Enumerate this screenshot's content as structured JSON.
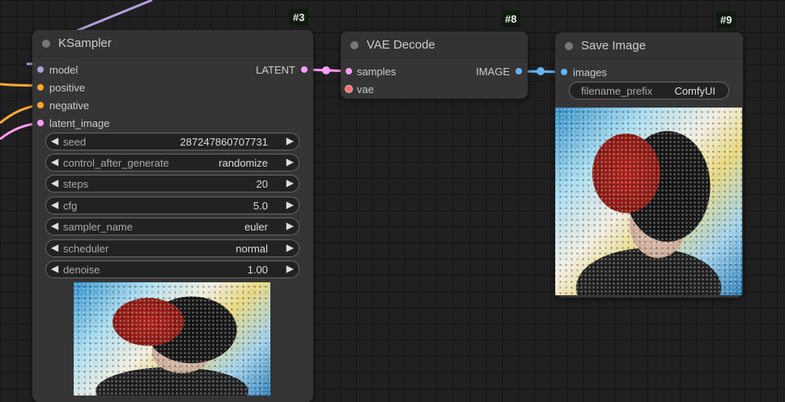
{
  "nodes": {
    "ksampler": {
      "id": "#3",
      "title": "KSampler",
      "inputs": [
        "model",
        "positive",
        "negative",
        "latent_image"
      ],
      "output": "LATENT",
      "widgets": [
        {
          "label": "seed",
          "value": "287247860707731"
        },
        {
          "label": "control_after_generate",
          "value": "randomize"
        },
        {
          "label": "steps",
          "value": "20"
        },
        {
          "label": "cfg",
          "value": "5.0"
        },
        {
          "label": "sampler_name",
          "value": "euler"
        },
        {
          "label": "scheduler",
          "value": "normal"
        },
        {
          "label": "denoise",
          "value": "1.00"
        }
      ]
    },
    "vae_decode": {
      "id": "#8",
      "title": "VAE Decode",
      "inputs": [
        "samples",
        "vae"
      ],
      "output": "IMAGE"
    },
    "save_image": {
      "id": "#9",
      "title": "Save Image",
      "inputs": [
        "images"
      ],
      "widget": {
        "label": "filename_prefix",
        "value": "ComfyUI"
      }
    }
  },
  "colors": {
    "model": "#b39ddb",
    "conditioning": "#ffa931",
    "latent": "#ff9cf9",
    "vae": "#ff6e6e",
    "image": "#64b5f6"
  },
  "icons": {
    "decrement": "◀",
    "increment": "▶"
  }
}
